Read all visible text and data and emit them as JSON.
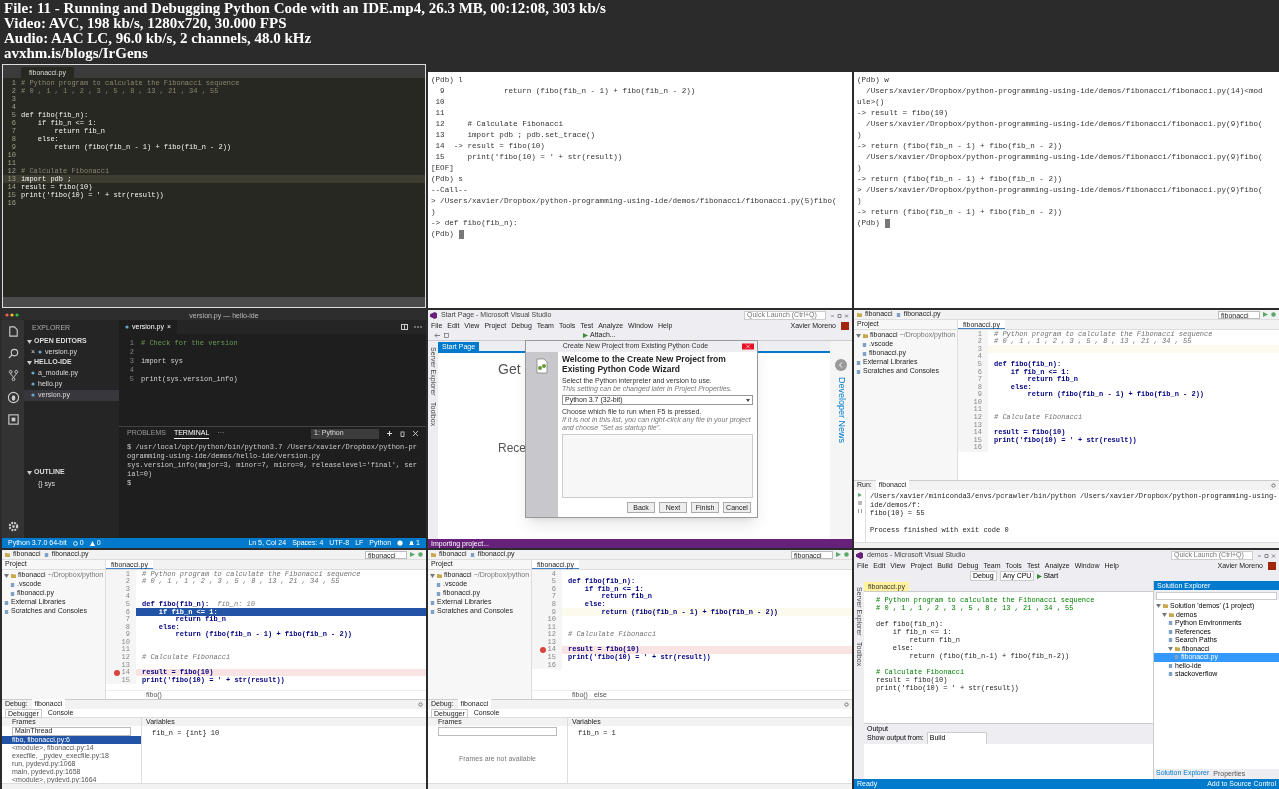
{
  "header": {
    "lines": [
      "File: 11 - Running and Debugging Python Code with an IDE.mp4, 26.3 MB, 00:12:08, 303 kb/s",
      "Video: AVC, 198 kb/s, 1280x720, 30.000 FPS",
      "Audio: AAC LC, 96.0 kb/s, 2 channels, 48.0 kHz",
      "avxhm.is/blogs/IrGens"
    ]
  },
  "tiles": [
    {
      "kind": "sublime",
      "tab": "fibonacci.py",
      "lines": [
        {
          "no": "1",
          "text": "# Python program to calculate the Fibonacci sequence",
          "comment": true
        },
        {
          "no": "2",
          "text": "# 0 , 1 , 1 , 2 , 3 , 5 , 8 , 13 , 21 , 34 , 55",
          "comment": true
        },
        {
          "no": "3"
        },
        {
          "no": "4"
        },
        {
          "no": "5",
          "text": "def fibo(fib_n):"
        },
        {
          "no": "6",
          "text": "    if fib_n <= 1:"
        },
        {
          "no": "7",
          "text": "        return fib_n"
        },
        {
          "no": "8",
          "text": "    else:"
        },
        {
          "no": "9",
          "text": "        return (fibo(fib_n - 1) + fibo(fib_n - 2))"
        },
        {
          "no": "10"
        },
        {
          "no": "11"
        },
        {
          "no": "12",
          "text": "# Calculate Fibonacci",
          "comment": true
        },
        {
          "no": "13",
          "text": "import pdb ;",
          "current": true
        },
        {
          "no": "14",
          "text": "result = fibo(10)"
        },
        {
          "no": "15",
          "text": "print('fibo(10) = ' + str(result))"
        },
        {
          "no": "16"
        }
      ]
    },
    {
      "kind": "terminal",
      "lines": [
        {
          "text": "(Pdb) l"
        },
        {
          "text": "  9             return (fibo(fib_n - 1) + fibo(fib_n - 2))"
        },
        {
          "text": " 10"
        },
        {
          "text": " 11"
        },
        {
          "text": " 12     # Calculate Fibonacci"
        },
        {
          "text": " 13     import pdb ; pdb.set_trace()"
        },
        {
          "text": " 14  -> result = fibo(10)"
        },
        {
          "text": " 15     print('fibo(10) = ' + str(result))"
        },
        {
          "text": "[EOF]"
        },
        {
          "text": "(Pdb) s"
        },
        {
          "text": "--Call--"
        },
        {
          "text": "> /Users/xavier/Dropbox/python-programming-using-ide/demos/fibonacci/fibonacci.py(5)fibo("
        },
        {
          "text": ")"
        },
        {
          "text": "-> def fibo(fib_n):"
        },
        {
          "text": "(Pdb)",
          "cursor": true
        }
      ]
    },
    {
      "kind": "terminal",
      "lines": [
        {
          "text": "(Pdb) w"
        },
        {
          "text": "  /Users/xavier/Dropbox/python-programming-using-ide/demos/fibonacci/fibonacci.py(14)<mod"
        },
        {
          "text": "ule>()"
        },
        {
          "text": "-> result = fibo(10)"
        },
        {
          "text": "  /Users/xavier/Dropbox/python-programming-using-ide/demos/fibonacci/fibonacci.py(9)fibo("
        },
        {
          "text": ")"
        },
        {
          "text": "-> return (fibo(fib_n - 1) + fibo(fib_n - 2))"
        },
        {
          "text": "  /Users/xavier/Dropbox/python-programming-using-ide/demos/fibonacci/fibonacci.py(9)fibo("
        },
        {
          "text": ")"
        },
        {
          "text": "-> return (fibo(fib_n - 1) + fibo(fib_n - 2))"
        },
        {
          "text": "> /Users/xavier/Dropbox/python-programming-using-ide/demos/fibonacci/fibonacci.py(9)fibo("
        },
        {
          "text": ")"
        },
        {
          "text": "-> return (fibo(fib_n - 1) + fibo(fib_n - 2))"
        },
        {
          "text": "(Pdb)",
          "cursor": true
        }
      ]
    },
    {
      "kind": "vscode",
      "title": "version.py — hello-ide",
      "explorer": "EXPLORER",
      "sections": [
        {
          "label": "OPEN EDITORS",
          "items": [
            {
              "label": "version.py",
              "close": "×",
              "selected": false
            }
          ]
        },
        {
          "label": "HELLO-IDE",
          "items": [
            {
              "label": "a_module.py",
              "selected": false
            },
            {
              "label": "hello.py",
              "selected": false
            },
            {
              "label": "version.py",
              "selected": true
            }
          ]
        }
      ],
      "outline": {
        "label": "OUTLINE",
        "items": [
          "{} sys"
        ]
      },
      "tab": "version.py",
      "tab_close": "×",
      "lines": [
        {
          "no": "1",
          "text": "# Check for the version",
          "comment": true
        },
        {
          "no": "2"
        },
        {
          "no": "3",
          "text": "import sys"
        },
        {
          "no": "4"
        },
        {
          "no": "5",
          "text": "print(sys.version_info)"
        }
      ],
      "panel_tabs": [
        {
          "label": "PROBLEMS",
          "selected": false
        },
        {
          "label": "TERMINAL",
          "selected": true
        },
        {
          "label": "···",
          "selected": false
        }
      ],
      "terminal_select": "1: Python",
      "terminal": [
        "$ /usr/local/opt/python/bin/python3.7 /Users/xavier/Dropbox/python-programming-using-ide/demos/hello-ide/version.py",
        "sys.version_info(major=3, minor=7, micro=0, releaselevel='final', serial=0)",
        "$"
      ],
      "status_left": "Python 3.7.0 64-bit",
      "errors": "0",
      "warnings": "0",
      "status_right": [
        "Ln 5, Col 24",
        "Spaces: 4",
        "UTF-8",
        "LF",
        "Python"
      ],
      "notifications": "1"
    },
    {
      "kind": "vs-wizard",
      "title": "Start Page - Microsoft Visual Studio",
      "quick_launch": "Quick Launch (Ctrl+Q)",
      "user": "Xavier Moreno",
      "menu": [
        "File",
        "Edit",
        "View",
        "Project",
        "Debug",
        "Team",
        "Tools",
        "Test",
        "Analyze",
        "Window",
        "Help"
      ],
      "toolbar_button": "Attach...",
      "side_tabs": [
        "Server Explorer",
        "Toolbox"
      ],
      "doc_tab": "Start Page",
      "start_heading": "Get",
      "recent_heading": "Rece",
      "side_panel": "Developer News",
      "dialog": {
        "title": "Create New Project from Existing Python Code",
        "heading": "Welcome to the Create New Project from Existing Python Code Wizard",
        "interpreter_label": "Select the Python interpreter and version to use.",
        "interpreter_hint": "This setting can be changed later in Project Properties.",
        "interpreter": "Python 3.7 (32-bit)",
        "file_label": "Choose which file to run when F5 is pressed.",
        "file_hint": "If it is not in this list, you can right-click any file in your project and choose \"Set as startup file\".",
        "buttons": [
          "Back",
          "Next",
          "Finish",
          "Cancel"
        ]
      },
      "status": "Importing project..."
    },
    {
      "kind": "pycharm",
      "nav": [
        "fibonacci",
        "fibonacci.py"
      ],
      "run_config": "fibonacci",
      "project_label": "Project",
      "tree": [
        {
          "label": "fibonacci",
          "hint": "~/Dropbox/python",
          "children": [
            {
              "label": ".vscode"
            },
            {
              "label": "fibonacci.py"
            }
          ]
        },
        {
          "label": "External Libraries"
        },
        {
          "label": "Scratches and Consoles"
        }
      ],
      "tab": "fibonacci.py",
      "lines": [
        {
          "no": "1",
          "text": "# Python program to calculate the Fibonacci sequence",
          "comment": true
        },
        {
          "no": "2",
          "text": "# 0 , 1 , 1 , 2 , 3 , 5 , 8 , 13 , 21 , 34 , 55",
          "comment": true
        },
        {
          "no": "3",
          "caret_line": true
        },
        {
          "no": "4"
        },
        {
          "no": "5",
          "text": "def fibo(fib_n):"
        },
        {
          "no": "6",
          "text": "    if fib_n <= 1:"
        },
        {
          "no": "7",
          "text": "        return fib_n"
        },
        {
          "no": "8",
          "text": "    else:"
        },
        {
          "no": "9",
          "text": "        return (fibo(fib_n - 1) + fibo(fib_n - 2))"
        },
        {
          "no": "10"
        },
        {
          "no": "11"
        },
        {
          "no": "12",
          "text": "# Calculate Fibonacci",
          "comment": true
        },
        {
          "no": "13"
        },
        {
          "no": "14",
          "text": "result = fibo(10)"
        },
        {
          "no": "15",
          "text": "print('fibo(10) = ' + str(result))"
        },
        {
          "no": "16"
        }
      ],
      "bottom": {
        "kind": "run",
        "label": "Run:",
        "tab": "fibonacci",
        "output": [
          {
            "text": "/Users/xavier/miniconda3/envs/pcrawler/bin/python /Users/xavier/Dropbox/python-programming-using-ide/demos/f:"
          },
          {
            "text": "fibo(10) = 55"
          },
          {
            "text": "Process finished with exit code 0",
            "gap_before": true
          }
        ]
      }
    },
    {
      "kind": "pycharm",
      "nav": [
        "fibonacci",
        "fibonacci.py"
      ],
      "run_config": "fibonacci",
      "project_label": "Project",
      "tree": [
        {
          "label": "fibonacci",
          "hint": "~/Dropbox/python",
          "children": [
            {
              "label": ".vscode"
            },
            {
              "label": "fibonacci.py"
            }
          ]
        },
        {
          "label": "External Libraries"
        },
        {
          "label": "Scratches and Consoles"
        }
      ],
      "tab": "fibonacci.py",
      "lines": [
        {
          "no": "1",
          "text": "# Python program to calculate the Fibonacci sequence",
          "comment": true
        },
        {
          "no": "2",
          "text": "# 0 , 1 , 1 , 2 , 3 , 5 , 8 , 13 , 21 , 34 , 55",
          "comment": true
        },
        {
          "no": "3"
        },
        {
          "no": "4"
        },
        {
          "no": "5",
          "text": "def fibo(fib_n):",
          "hint": "fib_n: 10"
        },
        {
          "no": "6",
          "text": "    if fib_n <= 1:",
          "current": true
        },
        {
          "no": "7",
          "text": "        return fib_n"
        },
        {
          "no": "8",
          "text": "    else:"
        },
        {
          "no": "9",
          "text": "        return (fibo(fib_n - 1) + fibo(fib_n - 2))"
        },
        {
          "no": "10"
        },
        {
          "no": "11"
        },
        {
          "no": "12",
          "text": "# Calculate Fibonacci",
          "comment": true
        },
        {
          "no": "13"
        },
        {
          "no": "14",
          "text": "result = fibo(10)",
          "breakpoint": true
        },
        {
          "no": "15",
          "text": "print('fibo(10) = ' + str(result))"
        }
      ],
      "breadcrumb": [
        "fibo()"
      ],
      "bottom": {
        "kind": "debug",
        "label": "Debug:",
        "tab": "fibonacci",
        "tabs": [
          "Debugger",
          "Console"
        ],
        "frames_label": "Frames",
        "variables_label": "Variables",
        "thread": "MainThread",
        "frames": [
          {
            "label": "fibo, fibonacci.py:6",
            "selected": true
          },
          {
            "label": "<module>, fibonacci.py:14",
            "selected": false
          },
          {
            "label": "execfile, _pydev_execfile.py:18",
            "selected": false
          },
          {
            "label": "run, pydevd.py:1068",
            "selected": false
          },
          {
            "label": "main, pydevd.py:1658",
            "selected": false
          },
          {
            "label": "<module>, pydevd.py:1664",
            "selected": false
          }
        ],
        "variables": [
          "fib_n = {int} 10"
        ]
      }
    },
    {
      "kind": "pycharm",
      "nav": [
        "fibonacci",
        "fibonacci.py"
      ],
      "run_config": "fibonacci",
      "project_label": "Project",
      "tree": [
        {
          "label": "fibonacci",
          "hint": "~/Dropbox/python",
          "children": [
            {
              "label": ".vscode"
            },
            {
              "label": "fibonacci.py"
            }
          ]
        },
        {
          "label": "External Libraries"
        },
        {
          "label": "Scratches and Consoles"
        }
      ],
      "tab": "fibonacci.py",
      "lines": [
        {
          "no": "4"
        },
        {
          "no": "5",
          "text": "def fibo(fib_n):"
        },
        {
          "no": "6",
          "text": "    if fib_n <= 1:"
        },
        {
          "no": "7",
          "text": "        return fib_n"
        },
        {
          "no": "8",
          "text": "    else:"
        },
        {
          "no": "9",
          "text": "        return (fibo(fib_n - 1) + fibo(fib_n - 2))",
          "caret_line": true
        },
        {
          "no": "10"
        },
        {
          "no": "11"
        },
        {
          "no": "12",
          "text": "# Calculate Fibonacci",
          "comment": true
        },
        {
          "no": "13"
        },
        {
          "no": "14",
          "text": "result = fibo(10)",
          "breakpoint": true
        },
        {
          "no": "15",
          "text": "print('fibo(10) = ' + str(result))"
        },
        {
          "no": "16"
        }
      ],
      "breadcrumb": [
        "fibo()",
        "else"
      ],
      "bottom": {
        "kind": "debug",
        "label": "Debug:",
        "tab": "fibonacci",
        "tabs": [
          "Debugger",
          "Console"
        ],
        "frames_label": "Frames",
        "variables_label": "Variables",
        "frames_empty": "Frames are not available",
        "variables": [
          "fib_n = 1"
        ]
      }
    },
    {
      "kind": "vs-editor",
      "title": "demos - Microsoft Visual Studio",
      "quick_launch": "Quick Launch (Ctrl+Q)",
      "user": "Xavier Moreno",
      "menu": [
        "File",
        "Edit",
        "View",
        "Project",
        "Build",
        "Debug",
        "Team",
        "Tools",
        "Test",
        "Analyze",
        "Window",
        "Help"
      ],
      "toolbar": [
        "Debug",
        "Any CPU",
        "Start"
      ],
      "side_tabs": [
        "Server Explorer",
        "Toolbox"
      ],
      "doc_tab": "fibonacci.py",
      "lines": [
        {
          "text": "# Python program to calculate the Fibonacci sequence",
          "comment": true
        },
        {
          "text": "# 0 , 1 , 1 , 2 , 3 , 5 , 8 , 13 , 21 , 34 , 55",
          "comment": true
        },
        {
          "text": "def fibo(fib_n):",
          "gap_before": true
        },
        {
          "text": "    if fib_n <= 1:"
        },
        {
          "text": "        return fib_n"
        },
        {
          "text": "    else:"
        },
        {
          "text": "        return (fibo(fib_n-1) + fibo(fib_n-2))"
        },
        {
          "text": "# Calculate Fibonacci",
          "comment": true,
          "gap_before": true
        },
        {
          "text": "result = fibo(10)"
        },
        {
          "text": "print('fibo(10) = ' + str(result))"
        }
      ],
      "output_title": "Output",
      "output_label": "Show output from:",
      "output_source": "Build",
      "solution_title": "Solution Explorer",
      "solution_tree": [
        {
          "label": "Solution 'demos' (1 project)",
          "children": [
            {
              "label": "demos",
              "children": [
                {
                  "label": "Python Environments"
                },
                {
                  "label": "References"
                },
                {
                  "label": "Search Paths"
                },
                {
                  "label": "fibonacci",
                  "children": [
                    {
                      "label": "fibonacci.py",
                      "selected": true
                    }
                  ]
                },
                {
                  "label": "hello-ide",
                  "selected": false
                },
                {
                  "label": "stackoverflow",
                  "selected": false
                }
              ]
            }
          ]
        }
      ],
      "bottom_tabs": [
        {
          "label": "Solution Explorer",
          "selected": true
        },
        {
          "label": "Properties",
          "selected": false
        }
      ],
      "status": "Ready",
      "status_right": "Add to Source Control"
    }
  ]
}
